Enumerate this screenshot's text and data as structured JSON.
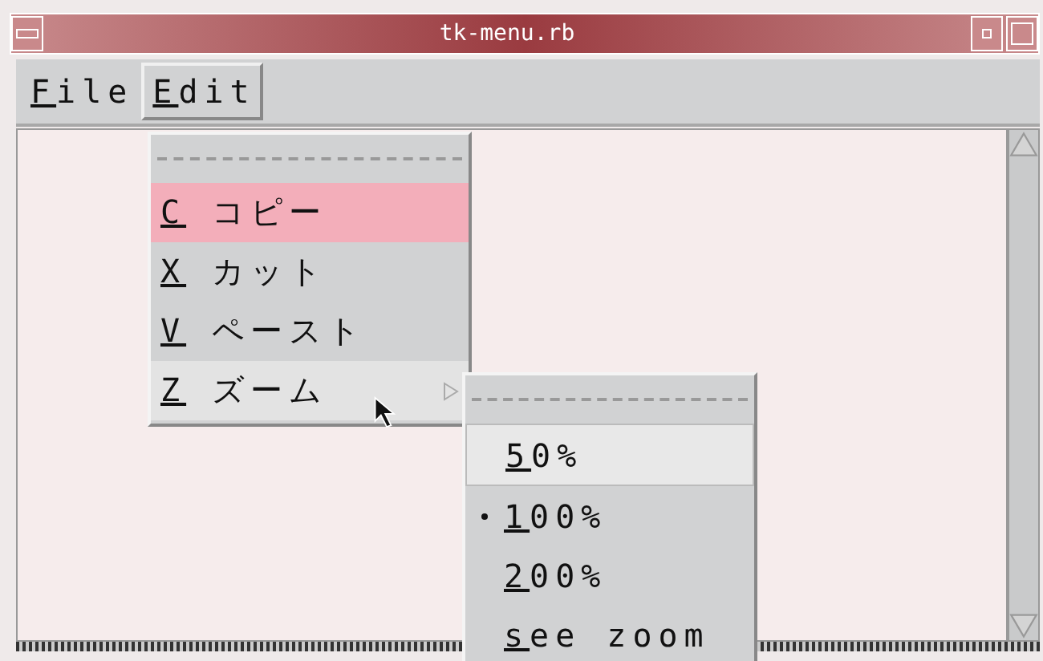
{
  "window": {
    "title": "tk-menu.rb"
  },
  "menubar": [
    {
      "label": "File",
      "selected": false
    },
    {
      "label": "Edit",
      "selected": true
    }
  ],
  "edit_menu": {
    "items": [
      {
        "kind": "command",
        "label": "C コピー",
        "active": true,
        "expanded": false
      },
      {
        "kind": "command",
        "label": "X カット",
        "active": false,
        "expanded": false
      },
      {
        "kind": "command",
        "label": "V ペースト",
        "active": false,
        "expanded": false
      },
      {
        "kind": "cascade",
        "label": "Z ズーム",
        "active": false,
        "expanded": true
      }
    ]
  },
  "zoom_menu": {
    "items": [
      {
        "label": "50%",
        "active": true,
        "selected": false
      },
      {
        "label": "100%",
        "active": false,
        "selected": true
      },
      {
        "label": "200%",
        "active": false,
        "selected": false
      },
      {
        "label": "see zoom",
        "active": false,
        "selected": false
      }
    ]
  }
}
